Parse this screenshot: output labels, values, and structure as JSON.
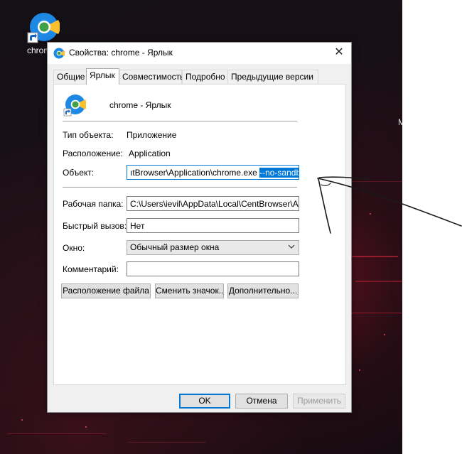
{
  "desktop": {
    "icon_label": "chrome - Ярлык",
    "edge_text": "M"
  },
  "dialog": {
    "title": "Свойства: chrome - Ярлык",
    "close_glyph": "✕",
    "tabs": [
      {
        "label": "Общие",
        "active": false
      },
      {
        "label": "Ярлык",
        "active": true
      },
      {
        "label": "Совместимость",
        "active": false
      },
      {
        "label": "Подробно",
        "active": false
      },
      {
        "label": "Предыдущие версии",
        "active": false
      }
    ],
    "shortcut_name": "chrome - Ярлык",
    "type_label": "Тип объекта:",
    "type_value": "Приложение",
    "location_label": "Расположение:",
    "location_value": "Application",
    "target_label": "Объект:",
    "target_value_plain": "ıtBrowser\\Application\\chrome.exe ",
    "target_value_selected": "--no-sandbox",
    "workdir_label": "Рабочая папка:",
    "workdir_value": "C:\\Users\\ievil\\AppData\\Local\\CentBrowser\\Application",
    "hotkey_label": "Быстрый вызов:",
    "hotkey_value": "Нет",
    "window_label": "Окно:",
    "window_value": "Обычный размер окна",
    "comment_label": "Комментарий:",
    "comment_value": "",
    "btn_file_location": "Расположение файла",
    "btn_change_icon": "Сменить значок...",
    "btn_advanced": "Дополнительно...",
    "btn_ok": "OK",
    "btn_cancel": "Отмена",
    "btn_apply": "Применить"
  },
  "colors": {
    "accent": "#0078d7",
    "dialog_bg": "#f0f0f0",
    "desktop_red": "#e6284a",
    "scribble": "#1a1a1a"
  },
  "icons": {
    "app": "chrome-like-icon",
    "shortcut_overlay": "shortcut-arrow-icon",
    "close": "close-icon",
    "dropdown": "chevron-down-icon"
  }
}
